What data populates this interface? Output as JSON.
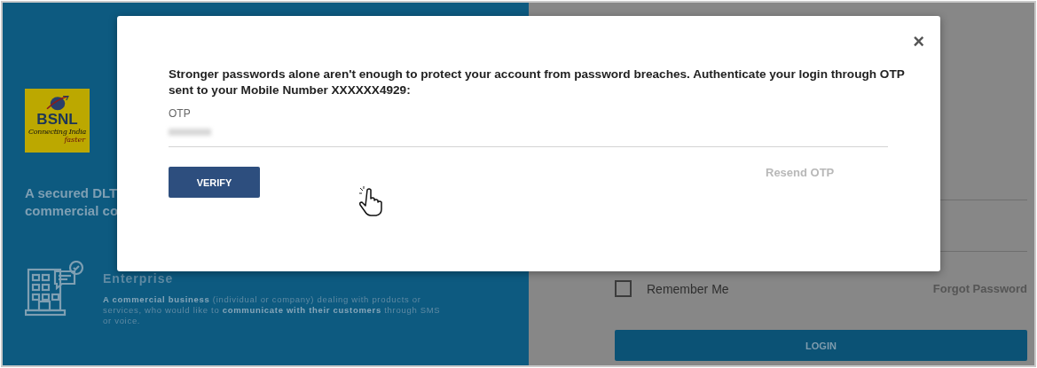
{
  "background": {
    "logo": {
      "name": "BSNL",
      "tagline": "Connecting India",
      "tagline_end": "faster"
    },
    "headline": [
      "A secured DLT",
      "commercial co"
    ],
    "enterprise": {
      "title": "Enterprise",
      "description": "**A commercial business** (individual or company) dealing with products or services, who would like to **communicate with their customers** through SMS or voice."
    },
    "remember_me": {
      "label": "Remember Me",
      "checked": false
    },
    "forgot_password": "Forgot Password",
    "login_button": "LOGIN"
  },
  "modal": {
    "close": "×",
    "message": "Stronger passwords alone aren't enough to protect your account from password breaches. Authenticate your login through OTP sent to your Mobile Number XXXXXX4929:",
    "otp_field": {
      "label": "OTP",
      "redacted": true
    },
    "verify_button": "VERIFY",
    "resend_link": "Resend OTP"
  }
}
